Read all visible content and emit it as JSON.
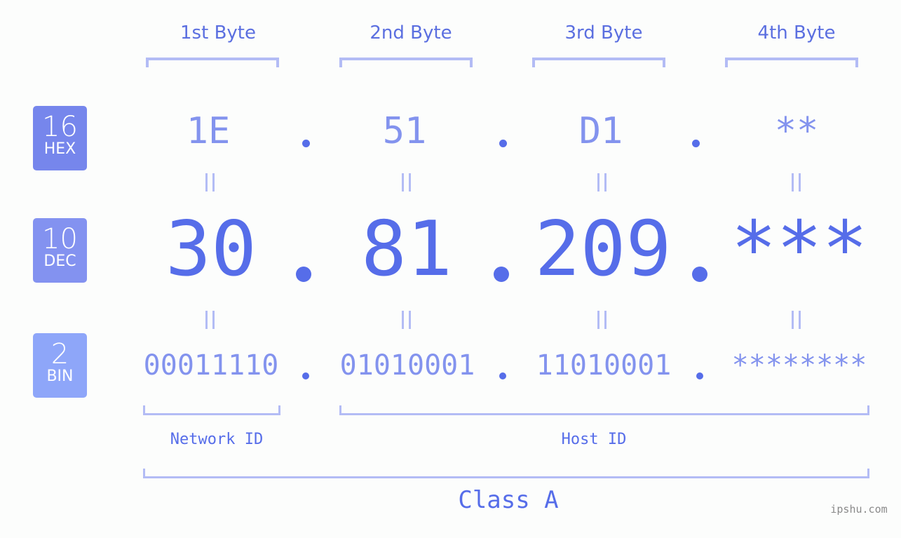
{
  "bytes": {
    "headers": [
      "1st Byte",
      "2nd Byte",
      "3rd Byte",
      "4th Byte"
    ]
  },
  "badges": {
    "hex": {
      "number": "16",
      "label": "HEX",
      "color": "#7686ec"
    },
    "dec": {
      "number": "10",
      "label": "DEC",
      "color": "#8392f0"
    },
    "bin": {
      "number": "2",
      "label": "BIN",
      "color": "#8ea6f9"
    }
  },
  "ip": {
    "hex": [
      "1E",
      "51",
      "D1",
      "**"
    ],
    "dec": [
      "30",
      "81",
      "209",
      "***"
    ],
    "bin": [
      "00011110",
      "01010001",
      "11010001",
      "********"
    ],
    "separator": ".",
    "equals_symbol": "="
  },
  "segments": {
    "network_id": "Network ID",
    "host_id": "Host ID",
    "class": "Class A"
  },
  "watermark": "ipshu.com",
  "colors": {
    "primary": "#566de9",
    "secondary": "#8393ee",
    "bracket": "#b3bcf5",
    "background": "#fcfdfc"
  }
}
